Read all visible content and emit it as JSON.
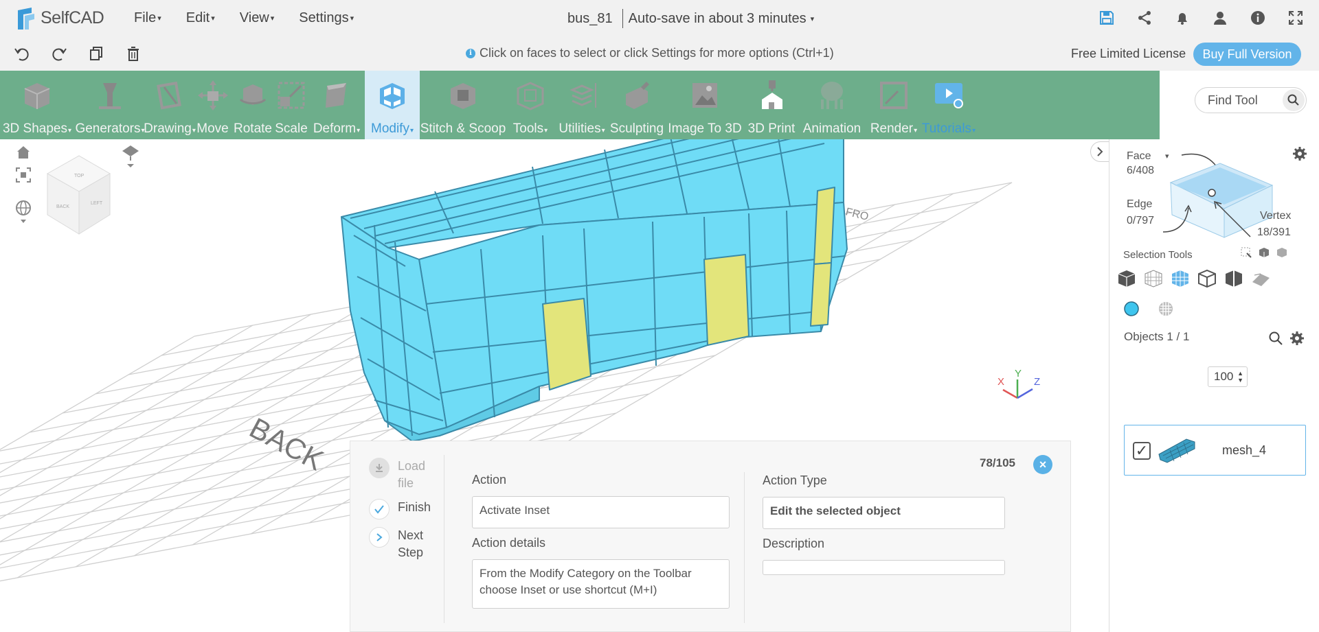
{
  "app": {
    "name": "SelfCAD"
  },
  "menus": [
    {
      "label": "File"
    },
    {
      "label": "Edit"
    },
    {
      "label": "View"
    },
    {
      "label": "Settings"
    }
  ],
  "document": {
    "title": "bus_81",
    "autosave": "Auto-save in about 3 minutes"
  },
  "top_icons": [
    "save-icon",
    "share-icon",
    "bell-icon",
    "user-icon",
    "info-icon",
    "fullscreen-icon"
  ],
  "subbar": {
    "hint": "Click on faces to select or click Settings for more options (Ctrl+1)",
    "license": "Free Limited License",
    "buy_label": "Buy Full Version"
  },
  "toolbar": {
    "tools": [
      {
        "label": "3D Shapes",
        "dropdown": true
      },
      {
        "label": "Generators",
        "dropdown": true
      },
      {
        "label": "Drawing",
        "dropdown": true
      },
      {
        "label": "Move",
        "dropdown": false
      },
      {
        "label": "Rotate",
        "dropdown": false
      },
      {
        "label": "Scale",
        "dropdown": false
      },
      {
        "label": "Deform",
        "dropdown": true
      },
      {
        "label": "Modify",
        "dropdown": true,
        "active": true
      },
      {
        "label": "Stitch & Scoop",
        "dropdown": false
      },
      {
        "label": "Tools",
        "dropdown": true
      },
      {
        "label": "Utilities",
        "dropdown": true
      },
      {
        "label": "Sculpting",
        "dropdown": false
      },
      {
        "label": "Image To 3D",
        "dropdown": false
      },
      {
        "label": "3D Print",
        "dropdown": false
      },
      {
        "label": "Animation",
        "dropdown": false
      },
      {
        "label": "Render",
        "dropdown": true
      },
      {
        "label": "Tutorials",
        "dropdown": true
      }
    ],
    "find_placeholder": "Find Tool"
  },
  "viewport": {
    "cube_labels": {
      "top": "TOP",
      "front": "BACK",
      "side": "LEFT"
    },
    "floor_labels": {
      "back": "BACK",
      "front": "FRO"
    },
    "axes": {
      "x": "X",
      "y": "Y",
      "z": "Z"
    }
  },
  "right_panel": {
    "face_label": "Face",
    "face_count": "6/408",
    "edge_label": "Edge",
    "edge_count": "0/797",
    "vertex_label": "Vertex",
    "vertex_count": "18/391",
    "selection_tools_label": "Selection Tools",
    "brush_size": "100",
    "objects_label": "Objects 1 / 1",
    "object_name": "mesh_4"
  },
  "tutorial": {
    "steps": [
      {
        "label": "Load file",
        "state": "done"
      },
      {
        "label": "Finish",
        "state": "check"
      },
      {
        "label": "Next Step",
        "state": "next"
      }
    ],
    "counter": "78/105",
    "action_label": "Action",
    "action_value": "Activate Inset",
    "action_details_label": "Action details",
    "action_details_value": "From the Modify Category on the Toolbar choose Inset or use shortcut (M+I)",
    "action_type_label": "Action Type",
    "action_type_value": "Edit the selected object",
    "description_label": "Description",
    "description_value": ""
  },
  "colors": {
    "toolbar_bg": "#6dae8b",
    "accent": "#62b4e9",
    "mesh": "#6fdcf6",
    "selected_face": "#e3e57b"
  }
}
